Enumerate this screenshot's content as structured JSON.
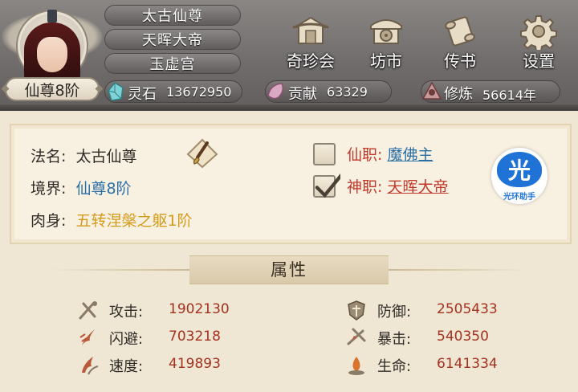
{
  "header": {
    "titles": [
      "太古仙尊",
      "天晖大帝",
      "玉虚宫"
    ],
    "rank_badge": "仙尊8阶",
    "menu": [
      {
        "label": "奇珍会",
        "icon": "treasure-pavilion-icon"
      },
      {
        "label": "坊市",
        "icon": "market-icon"
      },
      {
        "label": "传书",
        "icon": "scroll-letter-icon"
      },
      {
        "label": "设置",
        "icon": "gear-icon"
      }
    ],
    "resources": [
      {
        "name": "灵石",
        "value": "13672950",
        "icon": "spirit-stone-icon"
      },
      {
        "name": "贡献",
        "value": "63329",
        "icon": "contribution-icon"
      },
      {
        "name": "修炼",
        "value": "56614年",
        "icon": "cultivation-icon"
      }
    ]
  },
  "profile": {
    "dharma_name_label": "法名:",
    "dharma_name": "太古仙尊",
    "realm_label": "境界:",
    "realm": "仙尊8阶",
    "body_label": "肉身:",
    "body": "五转涅槃之躯1阶",
    "immortal_post_label": "仙职:",
    "immortal_post": "魔佛主",
    "divine_post_label": "神职:",
    "divine_post": "天晖大帝",
    "immortal_post_checked": false,
    "divine_post_checked": true
  },
  "helper_badge": {
    "glyph": "光",
    "text": "光环助手"
  },
  "attributes": {
    "title": "属性",
    "stats": [
      {
        "name": "攻击:",
        "value": "1902130",
        "icon": "attack-icon"
      },
      {
        "name": "防御:",
        "value": "2505433",
        "icon": "defense-icon"
      },
      {
        "name": "闪避:",
        "value": "703218",
        "icon": "dodge-icon"
      },
      {
        "name": "暴击:",
        "value": "540350",
        "icon": "critical-icon"
      },
      {
        "name": "速度:",
        "value": "419893",
        "icon": "speed-icon"
      },
      {
        "name": "生命:",
        "value": "6141334",
        "icon": "life-icon"
      }
    ]
  },
  "colors": {
    "stat_value": "#a3321f",
    "blue_text": "#2a6fa5",
    "gold_text": "#d49a1a",
    "red_text": "#c0392b"
  }
}
